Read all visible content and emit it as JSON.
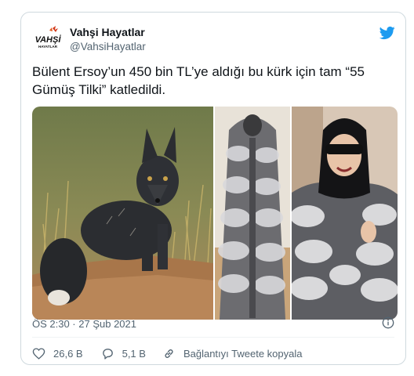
{
  "account": {
    "display_name": "Vahşi Hayatlar",
    "handle": "@VahsiHayatlar",
    "avatar_logo_text": "VAHŞİ",
    "avatar_logo_subtext": "HAYATLAR"
  },
  "tweet": {
    "text": "Bülent Ersoy’un 450 bin TL’ye aldığı bu kürk için tam “55 Gümüş Tilki” katledildi.",
    "timestamp": "ÖS 2:30 · 27 Şub 2021"
  },
  "media": {
    "count": 3,
    "items": [
      "black-silver-fox-photo",
      "silver-fox-fur-coat-photo",
      "woman-in-fur-coat-photo"
    ]
  },
  "actions": {
    "likes": "26,6 B",
    "replies": "5,1 B",
    "copy_link_label": "Bağlantıyı Tweete kopyala"
  },
  "icons": {
    "brand": "twitter-bird-icon",
    "info": "info-icon",
    "like": "heart-icon",
    "reply": "reply-icon",
    "link": "link-icon"
  },
  "colors": {
    "twitter_blue": "#1d9bf0",
    "like_red": "#f91880",
    "secondary_text": "#536471",
    "border": "#cfd9de"
  }
}
